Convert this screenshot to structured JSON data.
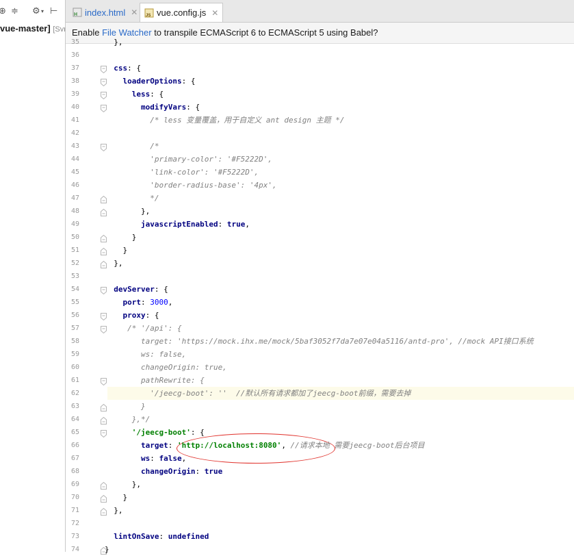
{
  "left_panel": {
    "project_name": "vue-master]",
    "project_extra": "[Svn"
  },
  "tabs": [
    {
      "label": "index.html",
      "icon": "html-file-icon"
    },
    {
      "label": "vue.config.js",
      "icon": "js-file-icon"
    }
  ],
  "notice": {
    "pre": "Enable ",
    "link": "File Watcher",
    "post": " to transpile ECMAScript 6 to ECMAScript 5 using Babel?"
  },
  "editor": {
    "highlight_line": 62,
    "lines": [
      {
        "n": "35",
        "t": "  },"
      },
      {
        "n": "36",
        "t": ""
      },
      {
        "n": "37",
        "t": "  css: {"
      },
      {
        "n": "38",
        "t": "    loaderOptions: {"
      },
      {
        "n": "39",
        "t": "      less: {"
      },
      {
        "n": "40",
        "t": "        modifyVars: {"
      },
      {
        "n": "41",
        "t": "          /* less 变量覆盖，用于自定义 ant design 主题 */"
      },
      {
        "n": "42",
        "t": ""
      },
      {
        "n": "43",
        "t": "          /*"
      },
      {
        "n": "44",
        "t": "          'primary-color': '#F5222D',"
      },
      {
        "n": "45",
        "t": "          'link-color': '#F5222D',"
      },
      {
        "n": "46",
        "t": "          'border-radius-base': '4px',"
      },
      {
        "n": "47",
        "t": "          */"
      },
      {
        "n": "48",
        "t": "        },"
      },
      {
        "n": "49",
        "t": "        javascriptEnabled: true,"
      },
      {
        "n": "50",
        "t": "      }"
      },
      {
        "n": "51",
        "t": "    }"
      },
      {
        "n": "52",
        "t": "  },"
      },
      {
        "n": "53",
        "t": ""
      },
      {
        "n": "54",
        "t": "  devServer: {"
      },
      {
        "n": "55",
        "t": "    port: 3000,"
      },
      {
        "n": "56",
        "t": "    proxy: {"
      },
      {
        "n": "57",
        "t": "     /* '/api': {"
      },
      {
        "n": "58",
        "t": "        target: 'https://mock.ihx.me/mock/5baf3052f7da7e07e04a5116/antd-pro', //mock API接口系统"
      },
      {
        "n": "59",
        "t": "        ws: false,"
      },
      {
        "n": "60",
        "t": "        changeOrigin: true,"
      },
      {
        "n": "61",
        "t": "        pathRewrite: {"
      },
      {
        "n": "62",
        "t": "          '/jeecg-boot': ''  //默认所有请求都加了jeecg-boot前缀，需要去掉"
      },
      {
        "n": "63",
        "t": "        }"
      },
      {
        "n": "64",
        "t": "      },*/"
      },
      {
        "n": "65",
        "t": "      '/jeecg-boot': {"
      },
      {
        "n": "66",
        "t": "        target: 'http://localhost:8080', //请求本地 需要jeecg-boot后台项目"
      },
      {
        "n": "67",
        "t": "        ws: false,"
      },
      {
        "n": "68",
        "t": "        changeOrigin: true"
      },
      {
        "n": "69",
        "t": "      },"
      },
      {
        "n": "70",
        "t": "    }"
      },
      {
        "n": "71",
        "t": "  },"
      },
      {
        "n": "72",
        "t": ""
      },
      {
        "n": "73",
        "t": "  lintOnSave: undefined"
      },
      {
        "n": "74",
        "t": "}"
      }
    ]
  },
  "colors": {
    "keyword": "#000080",
    "string": "#008000",
    "number": "#0000ff",
    "comment": "#808080",
    "highlight": "#fdfbe9",
    "annotation_oval": "#e0302a"
  }
}
